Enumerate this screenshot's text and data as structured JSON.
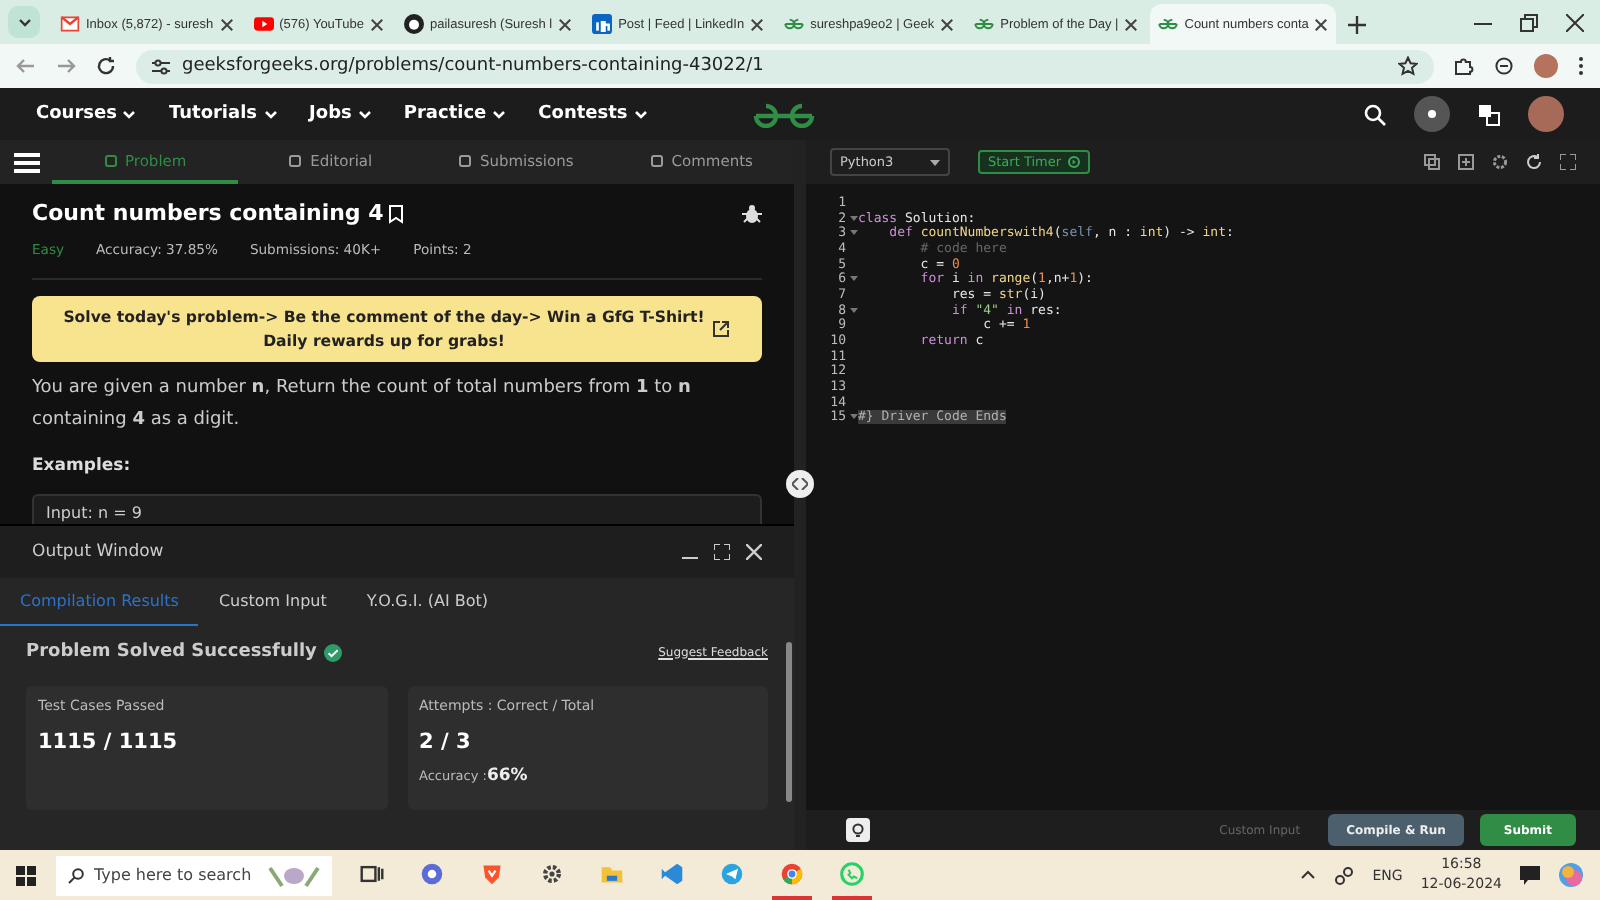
{
  "browser": {
    "tabs": [
      {
        "kind": "mail",
        "title": "Inbox (5,872) - suresh",
        "selected": false
      },
      {
        "kind": "video",
        "title": "(576) YouTube",
        "selected": false
      },
      {
        "kind": "github",
        "title": "pailasuresh (Suresh l",
        "selected": false
      },
      {
        "kind": "linkedin",
        "title": "Post | Feed | LinkedIn",
        "selected": false
      },
      {
        "kind": "gfg",
        "title": "sureshpa9eo2 | Geek",
        "selected": false
      },
      {
        "kind": "gfg",
        "title": "Problem of the Day |",
        "selected": false
      },
      {
        "kind": "gfg",
        "title": "Count numbers conta",
        "selected": true
      }
    ],
    "url": "geeksforgeeks.org/problems/count-numbers-containing-43022/1"
  },
  "site_nav": {
    "items": [
      "Courses",
      "Tutorials",
      "Jobs",
      "Practice",
      "Contests"
    ]
  },
  "problem_tabs": [
    {
      "label": "Problem",
      "selected": true
    },
    {
      "label": "Editorial",
      "selected": false
    },
    {
      "label": "Submissions",
      "selected": false
    },
    {
      "label": "Comments",
      "selected": false
    }
  ],
  "problem": {
    "title": "Count numbers containing 4",
    "difficulty": "Easy",
    "accuracy": "Accuracy: 37.85%",
    "submissions": "Submissions: 40K+",
    "points": "Points: 2",
    "banner": [
      "Solve today's problem-> Be the comment of the day-> Win a GfG T-Shirt!",
      "Daily rewards up for grabs!"
    ],
    "statement": "You are given a number **n**, Return the count of total numbers from **1** to **n** containing **4** as a digit.",
    "examples_heading": "Examples:",
    "example_input": "Input: n = 9"
  },
  "output_window": {
    "title": "Output Window",
    "tabs": [
      {
        "label": "Compilation Results",
        "selected": true
      },
      {
        "label": "Custom Input",
        "selected": false
      },
      {
        "label": "Y.O.G.I. (AI Bot)",
        "selected": false
      }
    ],
    "status": "Problem Solved Successfully",
    "feedback_link": "Suggest Feedback",
    "cards": [
      {
        "label": "Test Cases Passed",
        "value": "1115 / 1115"
      },
      {
        "label": "Attempts : Correct / Total",
        "value": "2 / 3",
        "accuracy_label": "Accuracy : ",
        "accuracy_value": "66%"
      }
    ]
  },
  "editor": {
    "language": "Python3",
    "timer_button": "Start Timer",
    "lines": [
      {
        "number": "1",
        "fold": false,
        "selected": false
      },
      {
        "number": "2",
        "fold": true,
        "selected": false,
        "tokens": [
          {
            "kind": "keyword",
            "text": "class"
          },
          {
            "kind": "plain",
            "text": " Solution:"
          }
        ]
      },
      {
        "number": "3",
        "fold": true,
        "selected": false,
        "tokens": [
          {
            "kind": "keyword",
            "text": "    def"
          },
          {
            "kind": "builtin",
            "text": " countNumberswith4"
          },
          {
            "kind": "plain",
            "text": "("
          },
          {
            "kind": "param",
            "text": "self"
          },
          {
            "kind": "plain",
            "text": ", n : "
          },
          {
            "kind": "builtin",
            "text": "int"
          },
          {
            "kind": "plain",
            "text": ") -> "
          },
          {
            "kind": "builtin",
            "text": "int"
          },
          {
            "kind": "plain",
            "text": ":"
          }
        ]
      },
      {
        "number": "4",
        "fold": false,
        "selected": false,
        "tokens": [
          {
            "kind": "comment",
            "text": "        # code here"
          }
        ]
      },
      {
        "number": "5",
        "fold": false,
        "selected": false,
        "tokens": [
          {
            "kind": "plain",
            "text": "        c = "
          },
          {
            "kind": "number",
            "text": "0"
          }
        ]
      },
      {
        "number": "6",
        "fold": true,
        "selected": false,
        "tokens": [
          {
            "kind": "keyword",
            "text": "        for"
          },
          {
            "kind": "plain",
            "text": " i "
          },
          {
            "kind": "keyword",
            "text": "in"
          },
          {
            "kind": "builtin",
            "text": " range"
          },
          {
            "kind": "plain",
            "text": "("
          },
          {
            "kind": "number",
            "text": "1"
          },
          {
            "kind": "plain",
            "text": ",n+"
          },
          {
            "kind": "number",
            "text": "1"
          },
          {
            "kind": "plain",
            "text": "):"
          }
        ]
      },
      {
        "number": "7",
        "fold": false,
        "selected": false,
        "tokens": [
          {
            "kind": "plain",
            "text": "            res = "
          },
          {
            "kind": "builtin",
            "text": "str"
          },
          {
            "kind": "plain",
            "text": "(i)"
          }
        ]
      },
      {
        "number": "8",
        "fold": true,
        "selected": false,
        "tokens": [
          {
            "kind": "keyword",
            "text": "            if"
          },
          {
            "kind": "string",
            "text": " \"4\""
          },
          {
            "kind": "keyword",
            "text": " in"
          },
          {
            "kind": "plain",
            "text": " res:"
          }
        ]
      },
      {
        "number": "9",
        "fold": false,
        "selected": false,
        "tokens": [
          {
            "kind": "plain",
            "text": "                c += "
          },
          {
            "kind": "number",
            "text": "1"
          }
        ]
      },
      {
        "number": "10",
        "fold": false,
        "selected": false,
        "tokens": [
          {
            "kind": "keyword",
            "text": "        return"
          },
          {
            "kind": "plain",
            "text": " c"
          }
        ]
      },
      {
        "number": "11",
        "fold": false,
        "selected": false
      },
      {
        "number": "12",
        "fold": false,
        "selected": false
      },
      {
        "number": "13",
        "fold": false,
        "selected": false
      },
      {
        "number": "14",
        "fold": false,
        "selected": false
      },
      {
        "number": "15",
        "fold": true,
        "selected": true,
        "tokens": [
          {
            "kind": "comment",
            "text": "#} Driver Code Ends"
          }
        ]
      }
    ],
    "custom_input": "Custom Input",
    "compile_button": "Compile & Run",
    "submit_button": "Submit"
  },
  "taskbar": {
    "search_placeholder": "Type here to search",
    "apps": [
      {
        "kind": "taskview",
        "running": false
      },
      {
        "kind": "copilot",
        "running": false
      },
      {
        "kind": "brave",
        "running": false
      },
      {
        "kind": "settings",
        "running": false
      },
      {
        "kind": "files",
        "running": false
      },
      {
        "kind": "vscode",
        "running": false
      },
      {
        "kind": "telegram",
        "running": false
      },
      {
        "kind": "chrome",
        "running": true
      },
      {
        "kind": "whatsapp",
        "running": true
      }
    ],
    "language": "ENG",
    "time": "16:58",
    "date": "12-06-2024"
  }
}
